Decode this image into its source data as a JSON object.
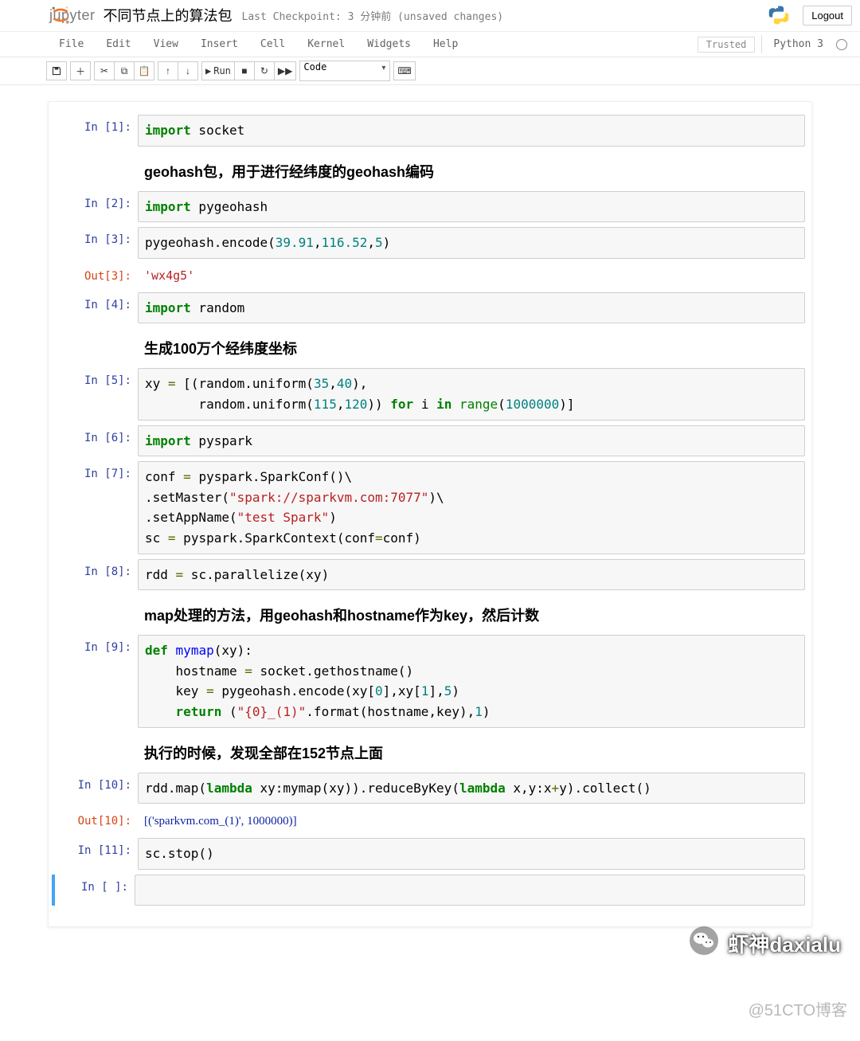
{
  "header": {
    "brand": "jupyter",
    "notebook_title": "不同节点上的算法包",
    "checkpoint": "Last Checkpoint: 3 分钟前  (unsaved changes)",
    "logout": "Logout"
  },
  "menu": {
    "items": [
      "File",
      "Edit",
      "View",
      "Insert",
      "Cell",
      "Kernel",
      "Widgets",
      "Help"
    ],
    "trusted": "Trusted",
    "kernel": "Python 3"
  },
  "toolbar": {
    "run_label": "Run",
    "celltype": "Code"
  },
  "cells": [
    {
      "type": "code",
      "prompt_in": "In [1]:",
      "code_html": "<span class='kw'>import</span> socket"
    },
    {
      "type": "markdown",
      "text": "geohash包，用于进行经纬度的geohash编码"
    },
    {
      "type": "code",
      "prompt_in": "In [2]:",
      "code_html": "<span class='kw'>import</span> pygeohash"
    },
    {
      "type": "code",
      "prompt_in": "In [3]:",
      "code_html": "pygeohash.encode(<span class='num'>39.91</span>,<span class='num'>116.52</span>,<span class='num'>5</span>)",
      "prompt_out": "Out[3]:",
      "output_html": "<span class='output-str'>'wx4g5'</span>"
    },
    {
      "type": "code",
      "prompt_in": "In [4]:",
      "code_html": "<span class='kw'>import</span> random"
    },
    {
      "type": "markdown",
      "text": "生成100万个经纬度坐标"
    },
    {
      "type": "code",
      "prompt_in": "In [5]:",
      "code_html": "xy <span class='op'>=</span> [(random.uniform(<span class='num'>35</span>,<span class='num'>40</span>),\n       random.uniform(<span class='num'>115</span>,<span class='num'>120</span>)) <span class='kw'>for</span> i <span class='kw'>in</span> <span class='bi'>range</span>(<span class='num'>1000000</span>)]"
    },
    {
      "type": "code",
      "prompt_in": "In [6]:",
      "code_html": "<span class='kw'>import</span> pyspark"
    },
    {
      "type": "code",
      "prompt_in": "In [7]:",
      "code_html": "conf <span class='op'>=</span> pyspark.SparkConf()\\\n.setMaster(<span class='str'>\"spark://sparkvm.com:7077\"</span>)\\\n.setAppName(<span class='str'>\"test Spark\"</span>)\nsc <span class='op'>=</span> pyspark.SparkContext(conf<span class='op'>=</span>conf)"
    },
    {
      "type": "code",
      "prompt_in": "In [8]:",
      "code_html": "rdd <span class='op'>=</span> sc.parallelize(xy)"
    },
    {
      "type": "markdown",
      "text": "map处理的方法，用geohash和hostname作为key，然后计数"
    },
    {
      "type": "code",
      "prompt_in": "In [9]:",
      "code_html": "<span class='kw'>def</span> <span class='fn'>mymap</span>(xy):\n    hostname <span class='op'>=</span> socket.gethostname()\n    key <span class='op'>=</span> pygeohash.encode(xy[<span class='num'>0</span>],xy[<span class='num'>1</span>],<span class='num'>5</span>)\n    <span class='kw'>return</span> (<span class='str'>\"{0}_(1)\"</span>.format(hostname,key),<span class='num'>1</span>)"
    },
    {
      "type": "markdown",
      "text": "执行的时候，发现全部在152节点上面"
    },
    {
      "type": "code",
      "prompt_in": "In [10]:",
      "code_html": "rdd.map(<span class='kw'>lambda</span> xy:mymap(xy)).reduceByKey(<span class='kw'>lambda</span> x,y:x<span class='op'>+</span>y).collect()",
      "prompt_out": "Out[10]:",
      "output_html": "<span class='output-special'>[('sparkvm.com_(1)', 1000000)]</span>"
    },
    {
      "type": "code",
      "prompt_in": "In [11]:",
      "code_html": "sc.stop()"
    },
    {
      "type": "code",
      "prompt_in": "In [ ]:",
      "code_html": "",
      "selected": true
    }
  ],
  "watermark": {
    "name": "虾神daxialu",
    "source": "@51CTO博客"
  }
}
